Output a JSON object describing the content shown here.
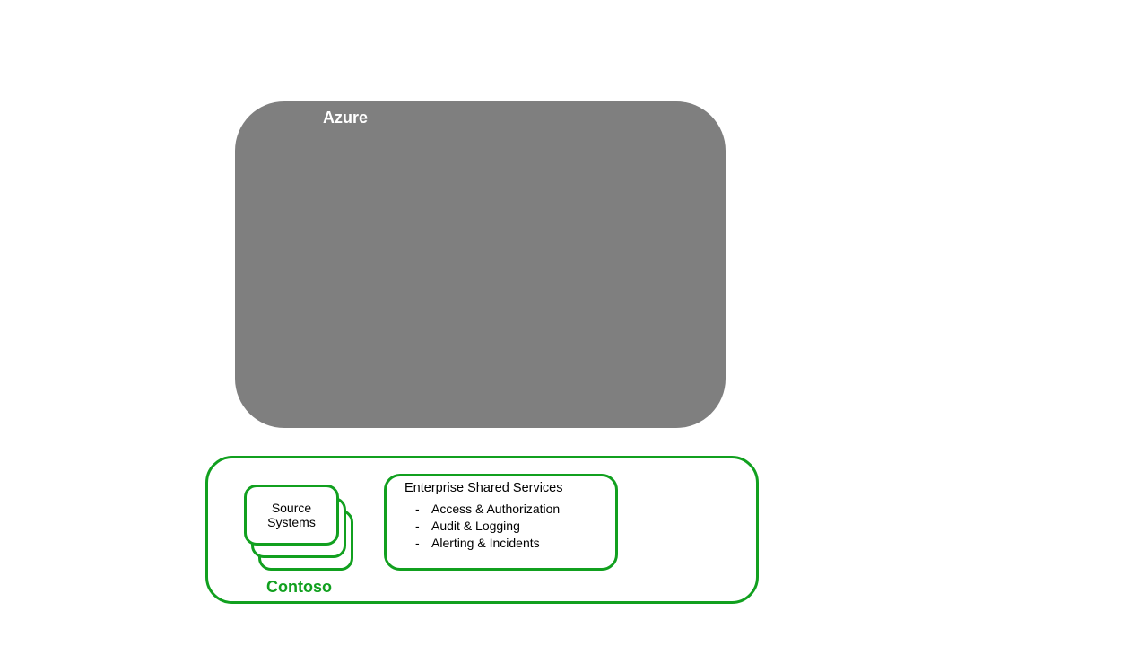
{
  "azure": {
    "label": "Azure"
  },
  "contoso": {
    "label": "Contoso",
    "source_systems": {
      "line1": "Source",
      "line2": "Systems"
    },
    "ess": {
      "title": "Enterprise Shared Services",
      "items": [
        "Access & Authorization",
        "Audit & Logging",
        "Alerting & Incidents"
      ]
    }
  }
}
